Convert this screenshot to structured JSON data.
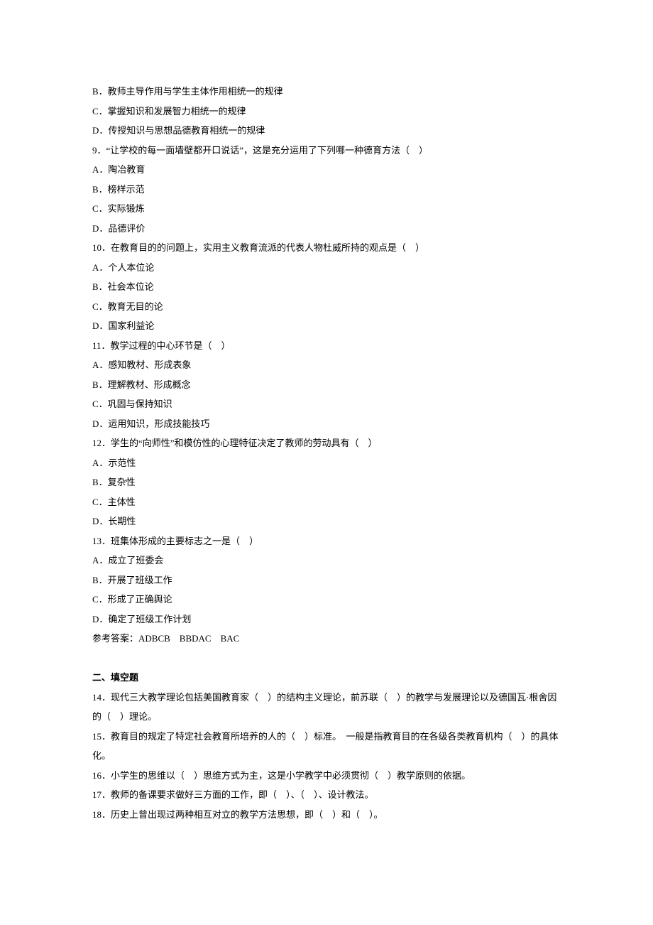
{
  "lines": [
    "B．教师主导作用与学生主体作用相统一的规律",
    "C．掌握知识和发展智力相统一的规律",
    "D．传授知识与思想品德教育相统一的规律",
    "9．“让学校的每一面墙壁都开口说话”，这是充分运用了下列哪一种德育方法（　）",
    "A．陶冶教育",
    "B．榜样示范",
    "C．实际锻炼",
    "D．品德评价",
    "10．在教育目的的问题上，实用主义教育流派的代表人物杜威所持的观点是（　）",
    "A．个人本位论",
    "B．社会本位论",
    "C．教育无目的论",
    "D．国家利益论",
    "11．教学过程的中心环节是（　）",
    "A．感知教材、形成表象",
    "B．理解教材、形成概念",
    "C．巩固与保持知识",
    "D．运用知识，形成技能技巧",
    "12．学生的“向师性”和模仿性的心理特征决定了教师的劳动具有（　）",
    "A．示范性",
    "B．复杂性",
    "C．主体性",
    "D．长期性",
    "13．班集体形成的主要标志之一是（　）",
    "A．成立了班委会",
    "B．开展了班级工作",
    "C．形成了正确舆论",
    "D．确定了班级工作计划",
    "参考答案：ADBCB　BBDAC　BAC"
  ],
  "section2": {
    "header": "二、填空题",
    "items": [
      "14．现代三大教学理论包括美国教育家（　）的结构主义理论，前苏联（　）的教学与发展理论以及德国瓦·根舍因的（　）理论。",
      "15．教育目的规定了特定社会教育所培养的人的（　）标准。　一般是指教育目的在各级各类教育机构（　）的具体化。",
      "16．小学生的思维以（　）思维方式为主，这是小学教学中必须贯彻（　）教学原则的依据。",
      "17．教师的备课要求做好三方面的工作，即（　）、（　）、设计教法。",
      "18．历史上曾出现过两种相互对立的教学方法思想，即（　）和（　）。"
    ]
  }
}
